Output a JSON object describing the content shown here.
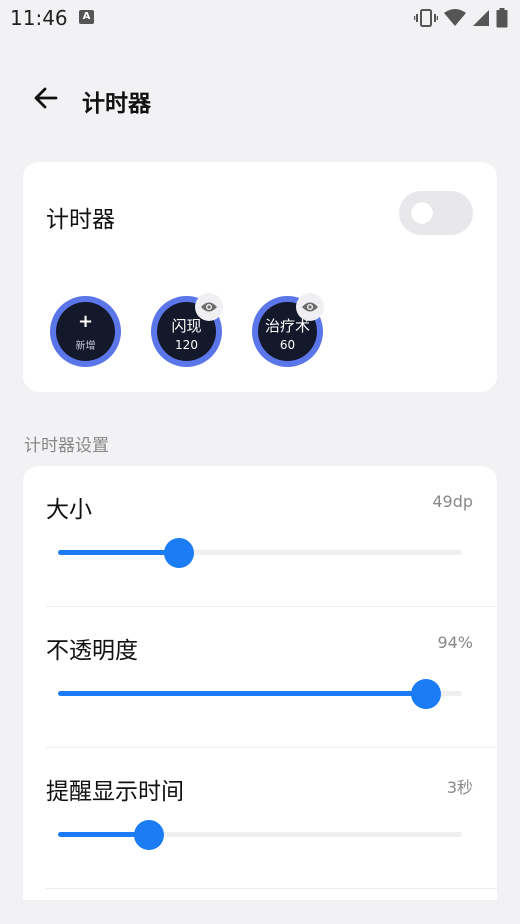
{
  "status_bar": {
    "time": "11:46",
    "notification_badge": "A"
  },
  "header": {
    "title": "计时器"
  },
  "timer_card": {
    "label": "计时器",
    "toggle_on": false,
    "add_item": {
      "plus": "+",
      "label": "新增"
    },
    "timers": [
      {
        "name": "闪现",
        "value": "120"
      },
      {
        "name": "治疗术",
        "value": "60"
      }
    ]
  },
  "settings_section": {
    "header": "计时器设置",
    "items": [
      {
        "label": "大小",
        "value": "49dp",
        "fraction": 0.3
      },
      {
        "label": "不透明度",
        "value": "94%",
        "fraction": 0.91
      },
      {
        "label": "提醒显示时间",
        "value": "3秒",
        "fraction": 0.225
      }
    ]
  },
  "colors": {
    "accent": "#1b7cf5",
    "timer_ring": "#5b76e8",
    "timer_fill": "#13182b",
    "background": "#f2f2f4"
  }
}
